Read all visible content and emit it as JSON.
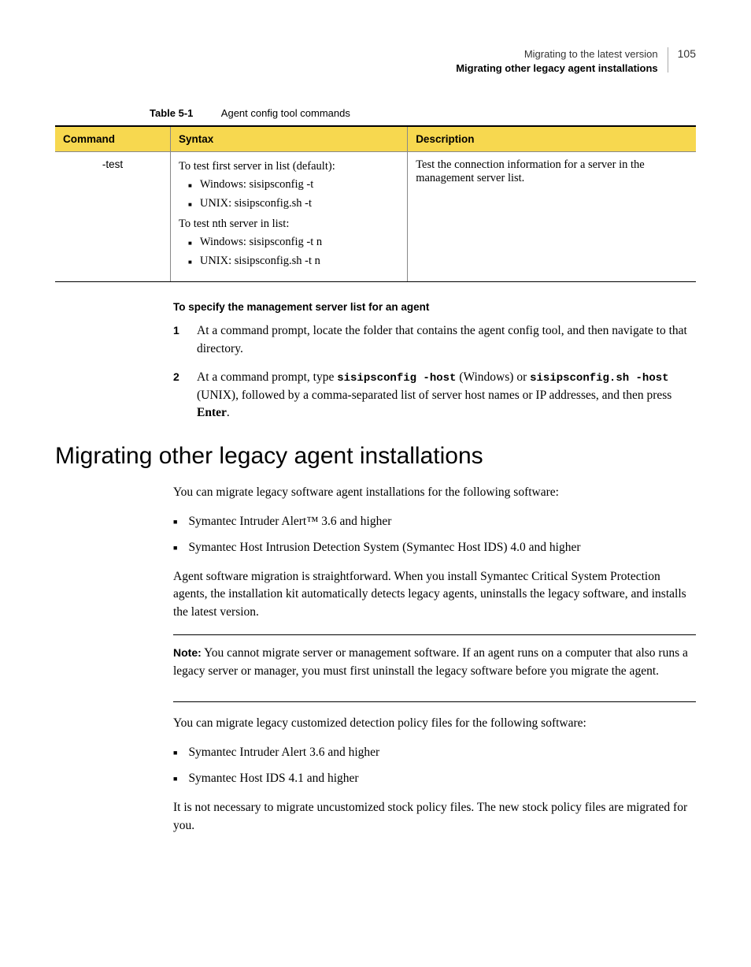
{
  "header": {
    "line1": "Migrating to the latest version",
    "line2": "Migrating other legacy agent installations",
    "page_number": "105"
  },
  "table": {
    "caption_label": "Table 5-1",
    "caption_text": "Agent config tool commands",
    "headers": {
      "command": "Command",
      "syntax": "Syntax",
      "description": "Description"
    },
    "row": {
      "command": "-test",
      "syntax_intro1": "To test first server in list (default):",
      "syntax_items1": {
        "a": "Windows: sisipsconfig -t",
        "b": "UNIX: sisipsconfig.sh -t"
      },
      "syntax_intro2": "To test nth server in list:",
      "syntax_items2": {
        "a": "Windows: sisipsconfig -t n",
        "b": "UNIX: sisipsconfig.sh -t n"
      },
      "description": "Test the connection information for a server in the management server list."
    }
  },
  "procedure": {
    "title": "To specify the management server list for an agent",
    "steps": {
      "1": "At a command prompt, locate the folder that contains the agent config tool, and then navigate to that directory.",
      "2_a": "At a command prompt, type ",
      "2_code1": "sisipsconfig -host",
      "2_b": " (Windows) or ",
      "2_code2": "sisipsconfig.sh -host",
      "2_c": " (UNIX), followed by a comma-separated list of server host names or IP addresses, and then press ",
      "2_bold": "Enter",
      "2_d": "."
    }
  },
  "heading": "Migrating other legacy agent installations",
  "body": {
    "p1": "You can migrate legacy software agent installations for the following software:",
    "list1": {
      "a": "Symantec Intruder Alert™ 3.6 and higher",
      "b": "Symantec Host Intrusion Detection System (Symantec Host IDS) 4.0 and higher"
    },
    "p2": "Agent software migration is straightforward. When you install Symantec Critical System Protection agents, the installation kit automatically detects legacy agents, uninstalls the legacy software, and installs the latest version.",
    "note_label": "Note:",
    "note_text": " You cannot migrate server or management software. If an agent runs on a computer that also runs a legacy server or manager, you must first uninstall the legacy software before you migrate the agent.",
    "p3": "You can migrate legacy customized detection policy files for the following software:",
    "list2": {
      "a": "Symantec Intruder Alert 3.6 and higher",
      "b": "Symantec Host IDS 4.1 and higher"
    },
    "p4": "It is not necessary to migrate uncustomized stock policy files. The new stock policy files are migrated for you."
  }
}
